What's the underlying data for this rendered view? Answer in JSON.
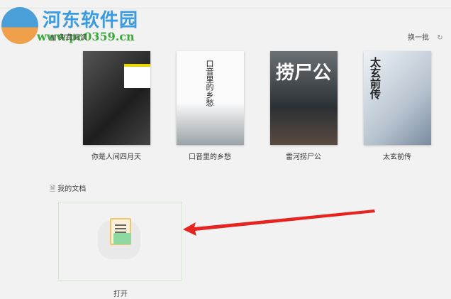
{
  "watermark": {
    "title": "河东软件园",
    "url": "www.pc0359.cn"
  },
  "free_reading": {
    "title": "免费阅读",
    "refresh_label": "换一批"
  },
  "books": [
    {
      "title": "你是人间四月天",
      "cover": "#2a2a2a"
    },
    {
      "title": "口音里的乡愁",
      "cover": "#e8e8e6"
    },
    {
      "title": "雷河捞尸公",
      "cover": "#3a3f44"
    },
    {
      "title": "太玄前传",
      "cover": "#cfd8e2"
    }
  ],
  "my_docs": {
    "title": "我的文档",
    "open_label": "打开"
  },
  "colors": {
    "arrow": "#e8231f",
    "card_border": "#c9e9c9"
  }
}
